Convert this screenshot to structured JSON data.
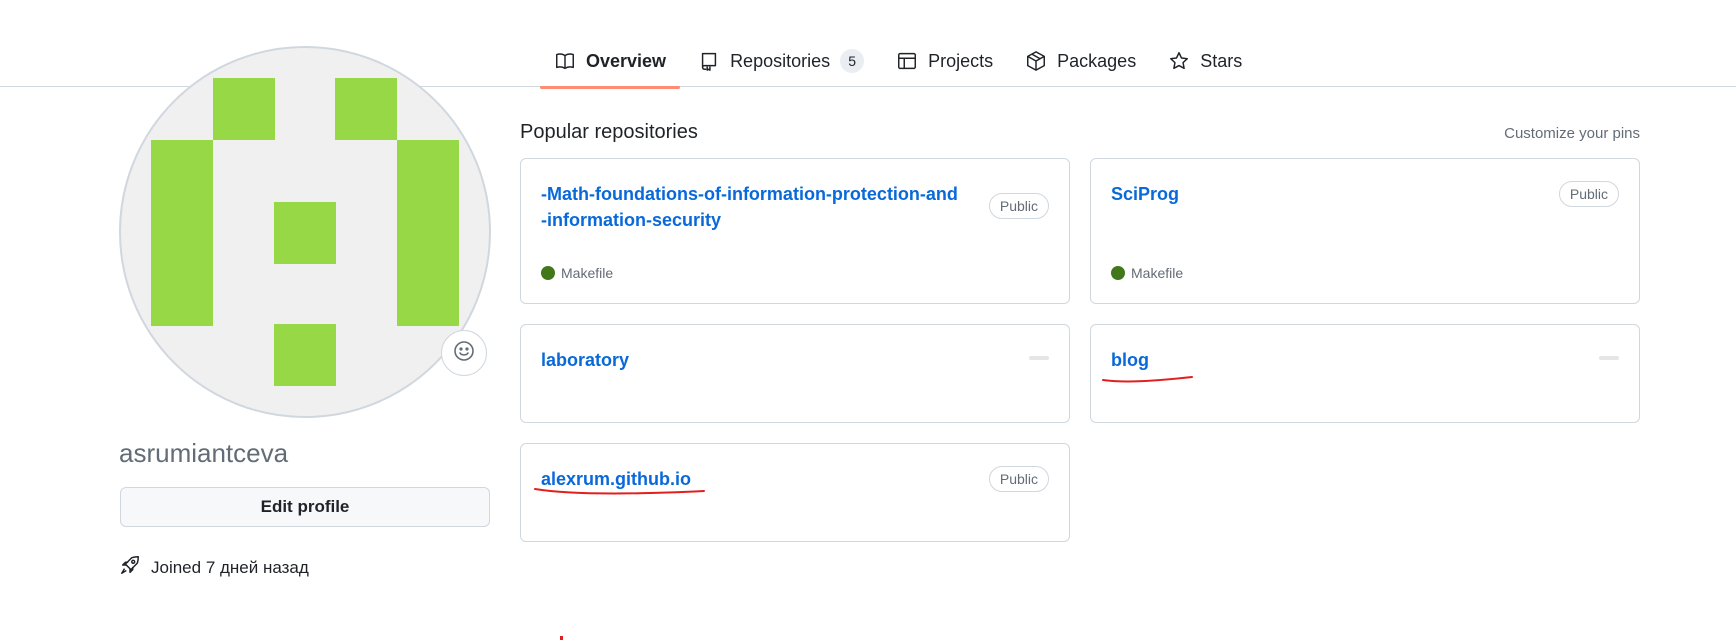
{
  "nav": {
    "tabs": [
      {
        "label": "Overview",
        "icon": "book-icon",
        "active": true
      },
      {
        "label": "Repositories",
        "icon": "repo-icon",
        "count": "5"
      },
      {
        "label": "Projects",
        "icon": "table-icon"
      },
      {
        "label": "Packages",
        "icon": "package-icon"
      },
      {
        "label": "Stars",
        "icon": "star-icon"
      }
    ],
    "active_underline_color": "#fd8c73"
  },
  "profile": {
    "username": "asrumiantceva",
    "edit_label": "Edit profile",
    "joined": "Joined 7 дней назад",
    "avatar_color": "#97d846"
  },
  "main": {
    "title": "Popular repositories",
    "customize": "Customize your pins",
    "repos": [
      {
        "name": "-Math-foundations-of-information-protection-and-information-security",
        "visibility": "Public",
        "language": "Makefile",
        "lang_color": "#427819"
      },
      {
        "name": "SciProg",
        "visibility": "Public",
        "language": "Makefile",
        "lang_color": "#427819"
      },
      {
        "name": "laboratory",
        "visibility": ""
      },
      {
        "name": "blog",
        "visibility": ""
      },
      {
        "name": "alexrum.github.io",
        "visibility": "Public"
      }
    ],
    "annotation_color": "#e21f1f"
  }
}
